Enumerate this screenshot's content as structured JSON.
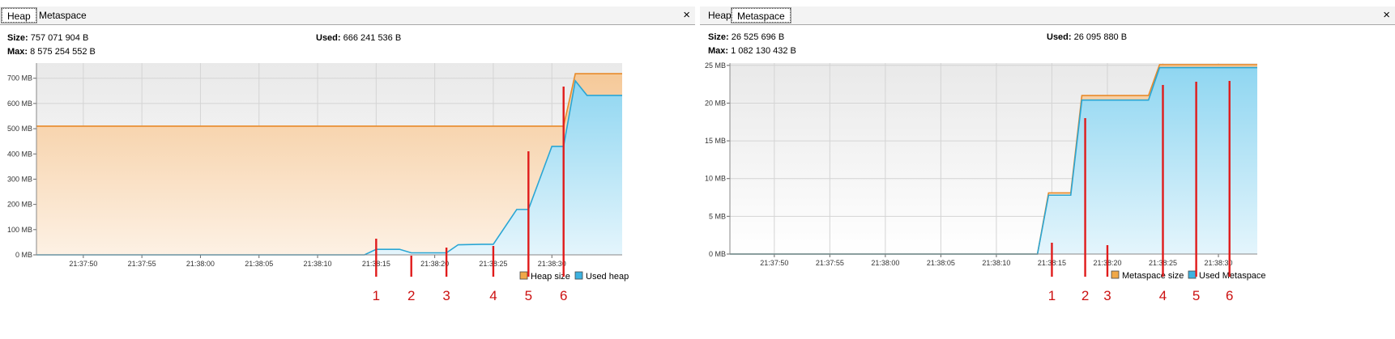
{
  "heap_panel": {
    "tabs": [
      {
        "label": "Heap",
        "active": true
      },
      {
        "label": "Metaspace",
        "active": false
      }
    ],
    "close_label": "×",
    "stats": {
      "size_label": "Size:",
      "size_value": "757 071 904 B",
      "used_label": "Used:",
      "used_value": "666 241 536 B",
      "max_label": "Max:",
      "max_value": "8 575 254 552 B"
    },
    "legend": [
      {
        "label": "Heap size",
        "color": "#f0a848"
      },
      {
        "label": "Used heap",
        "color": "#3db2e0"
      }
    ],
    "markers": [
      "1",
      "2",
      "3",
      "4",
      "5",
      "6"
    ]
  },
  "metaspace_panel": {
    "tabs": [
      {
        "label": "Heap",
        "active": false
      },
      {
        "label": "Metaspace",
        "active": true
      }
    ],
    "close_label": "×",
    "stats": {
      "size_label": "Size:",
      "size_value": "26 525 696 B",
      "used_label": "Used:",
      "used_value": "26 095 880 B",
      "max_label": "Max:",
      "max_value": "1 082 130 432 B"
    },
    "legend": [
      {
        "label": "Metaspace size",
        "color": "#f0a848"
      },
      {
        "label": "Used Metaspace",
        "color": "#3db2e0"
      }
    ],
    "markers": [
      "1",
      "2",
      "3",
      "4",
      "5",
      "6"
    ]
  },
  "chart_data": [
    {
      "type": "area",
      "x_ticks": [
        "21:37:50",
        "21:37:55",
        "21:38:00",
        "21:38:05",
        "21:38:10",
        "21:38:15",
        "21:38:20",
        "21:38:25",
        "21:38:30"
      ],
      "x_tick_seconds": [
        50,
        55,
        60,
        65,
        70,
        75,
        80,
        85,
        90
      ],
      "xlim_seconds": [
        46,
        96
      ],
      "y_ticks": [
        "0 MB",
        "100 MB",
        "200 MB",
        "300 MB",
        "400 MB",
        "500 MB",
        "600 MB",
        "700 MB"
      ],
      "ylim": [
        0,
        760
      ],
      "y_unit": "MB",
      "grid": true,
      "legend_position": "bottom-right",
      "series": [
        {
          "name": "Heap size",
          "x_seconds": [
            46,
            91,
            92,
            96
          ],
          "values": [
            510,
            510,
            718,
            718
          ]
        },
        {
          "name": "Used heap",
          "x_seconds": [
            46,
            74,
            75,
            77,
            78,
            80,
            81,
            82,
            84,
            85,
            87,
            88,
            90,
            91,
            92,
            93,
            96
          ],
          "values": [
            0,
            0,
            22,
            22,
            8,
            8,
            8,
            40,
            42,
            42,
            180,
            180,
            430,
            430,
            690,
            632,
            632
          ]
        }
      ],
      "markers": [
        {
          "label": "1",
          "x_seconds": 75
        },
        {
          "label": "2",
          "x_seconds": 78
        },
        {
          "label": "3",
          "x_seconds": 81
        },
        {
          "label": "4",
          "x_seconds": 85
        },
        {
          "label": "5",
          "x_seconds": 88
        },
        {
          "label": "6",
          "x_seconds": 91
        }
      ]
    },
    {
      "type": "area",
      "x_ticks": [
        "21:37:50",
        "21:37:55",
        "21:38:00",
        "21:38:05",
        "21:38:10",
        "21:38:15",
        "21:38:20",
        "21:38:25",
        "21:38:30"
      ],
      "x_tick_seconds": [
        50,
        55,
        60,
        65,
        70,
        75,
        80,
        85,
        90
      ],
      "xlim_seconds": [
        46,
        93.5
      ],
      "y_ticks": [
        "0 MB",
        "5 MB",
        "10 MB",
        "15 MB",
        "20 MB",
        "25 MB"
      ],
      "ylim": [
        0,
        25.3
      ],
      "y_unit": "MB",
      "grid": true,
      "legend_position": "bottom-right",
      "series": [
        {
          "name": "Metaspace size",
          "x_seconds": [
            46,
            73.7,
            74.7,
            76.7,
            77.7,
            83.7,
            84.7,
            93.5
          ],
          "values": [
            0,
            0,
            8.1,
            8.1,
            21,
            21,
            25.1,
            25.1
          ]
        },
        {
          "name": "Used Metaspace",
          "x_seconds": [
            46,
            73.7,
            74.7,
            76.7,
            77.7,
            83.7,
            84.7,
            93.5
          ],
          "values": [
            0,
            0,
            7.8,
            7.8,
            20.4,
            20.4,
            24.7,
            24.7
          ]
        }
      ],
      "markers": [
        {
          "label": "1",
          "x_seconds": 75
        },
        {
          "label": "2",
          "x_seconds": 78
        },
        {
          "label": "3",
          "x_seconds": 80
        },
        {
          "label": "4",
          "x_seconds": 85
        },
        {
          "label": "5",
          "x_seconds": 88
        },
        {
          "label": "6",
          "x_seconds": 91
        }
      ]
    }
  ]
}
